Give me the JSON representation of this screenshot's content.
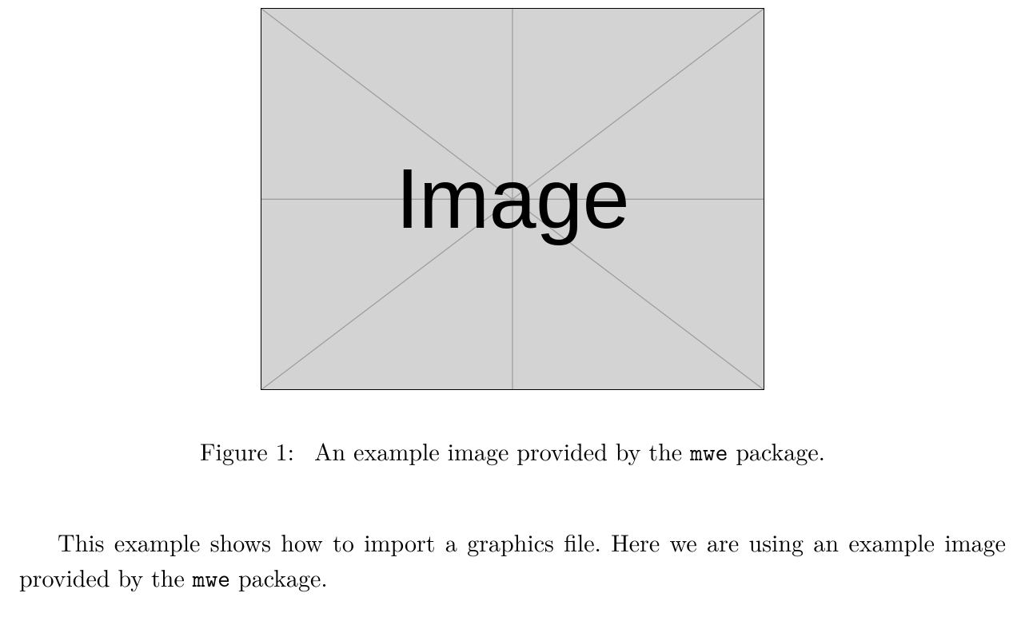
{
  "figure": {
    "placeholder_label": "Image",
    "caption_label": "Figure 1:",
    "caption_text_pre": "An example image provided by the",
    "caption_tt": "mwe",
    "caption_text_post": "package."
  },
  "paragraph": {
    "text_pre": "This example shows how to import a graphics file.  Here we are using an example image provided by the",
    "tt": "mwe",
    "text_post": "package."
  }
}
